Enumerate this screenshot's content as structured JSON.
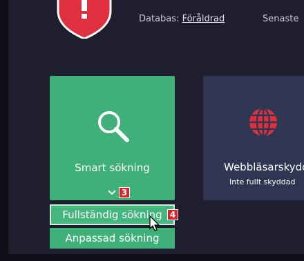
{
  "header": {
    "database_label": "Databas:",
    "database_value": "Föråldrad",
    "latest_label": "Senaste"
  },
  "tiles": {
    "smart_search": {
      "label": "Smart sökning",
      "icon": "search-icon",
      "color": "#3fb07a"
    },
    "web_protection": {
      "label": "Webbläsarskydd",
      "sublabel": "Inte fullt skyddad",
      "icon": "globe-icon",
      "color": "#2f3651"
    }
  },
  "dropdown": {
    "expand_badge": "3",
    "items": [
      {
        "label": "Fullständig sökning",
        "badge": "4"
      },
      {
        "label": "Anpassad sökning"
      }
    ]
  },
  "colors": {
    "background": "#1f1e2f",
    "accent_green": "#3fb07a",
    "shield_red": "#e0303f",
    "badge_red": "#d9232b"
  }
}
